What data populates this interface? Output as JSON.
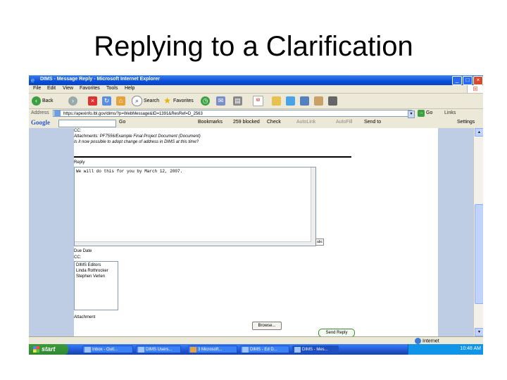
{
  "slide": {
    "title": "Replying to a Clarification"
  },
  "window": {
    "title": "DIMS - Message Reply - Microsoft Internet Explorer"
  },
  "menu": [
    "File",
    "Edit",
    "View",
    "Favorites",
    "Tools",
    "Help"
  ],
  "toolbar": {
    "back": "Back",
    "search": "Search",
    "favorites": "Favorites"
  },
  "address": {
    "label": "Address",
    "url": "https://apexinfo.lbl.gov/dims/?p=WebMessage&ID=1391&ResRef=D_2563",
    "go": "Go",
    "links": "Links"
  },
  "google": {
    "logo": "Google",
    "go": "Go",
    "bookmarks": "Bookmarks",
    "blocked": "259 blocked",
    "check": "Check",
    "autolink": "AutoLink",
    "autofill": "AutoFill",
    "sendto": "Send to",
    "settings": "Settings"
  },
  "message": {
    "cc_line": "CC:",
    "attachments": "Attachments: PF7556/Example Final Project Document (Document)",
    "body_line": "Is it now possible to adopt change of address in DIMS at this time?"
  },
  "form": {
    "reply_label": "Reply",
    "reply_value": "We will do this for you by March 12, 2007.",
    "date_label": "Due Date",
    "cc_label": "CC:",
    "cc_options": [
      "DIMS Editors",
      "Linda Rothrocker",
      "Stephen Verlen"
    ],
    "attach_label": "Attachment",
    "browse_button": "Browse...",
    "send_button": "Send Reply"
  },
  "statusbar": {
    "zone": "Internet"
  },
  "taskbar": {
    "start": "start",
    "tasks": [
      "Inbox - Outl...",
      "DIMS Users...",
      "3 Microsoft...",
      "DIMS - Ed D...",
      "DIMS - Mes..."
    ],
    "clock": "10:48 AM"
  }
}
